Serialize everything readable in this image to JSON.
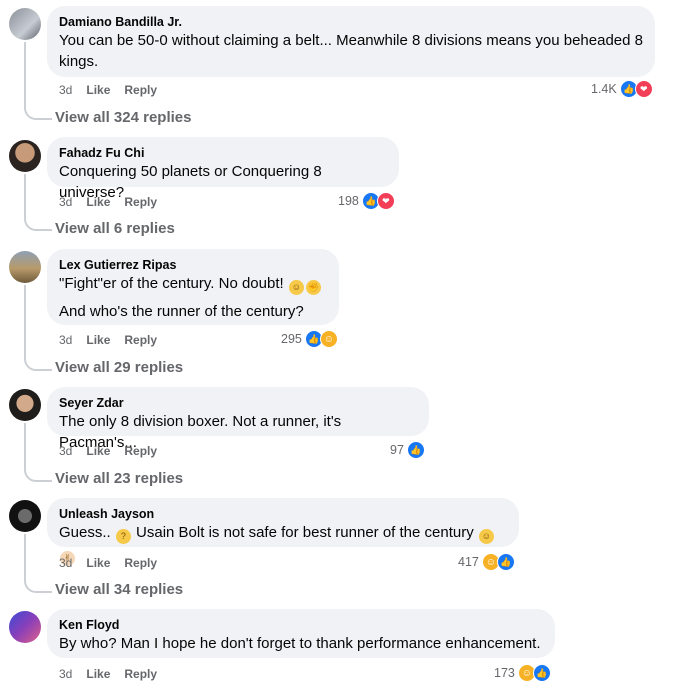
{
  "comments": [
    {
      "author": "Damiano Bandilla Jr.",
      "lines": [
        "You can be 50-0 without claiming a belt... Meanwhile 8 divisions means you beheaded 8",
        "kings."
      ],
      "time": "3d",
      "like": "Like",
      "reply": "Reply",
      "reaction_count": "1.4K",
      "reactions": [
        "like-icon",
        "love-icon"
      ],
      "view_all": "View all 324 replies"
    },
    {
      "author": "Fahadz Fu Chi",
      "lines": [
        "Conquering 50 planets or Conquering 8 universe?"
      ],
      "time": "3d",
      "like": "Like",
      "reply": "Reply",
      "reaction_count": "198",
      "reactions": [
        "like-icon",
        "love-icon"
      ],
      "view_all": "View all 6 replies"
    },
    {
      "author": "Lex Gutierrez Ripas",
      "lines": [
        "\"Fight\"er of the century. No doubt!",
        "And who's the runner of the century?"
      ],
      "time": "3d",
      "like": "Like",
      "reply": "Reply",
      "reaction_count": "295",
      "reactions": [
        "like-icon",
        "haha-icon"
      ],
      "view_all": "View all 29 replies"
    },
    {
      "author": "Seyer Zdar",
      "lines": [
        "The only 8 division boxer. Not a runner, it's Pacman's..."
      ],
      "time": "3d",
      "like": "Like",
      "reply": "Reply",
      "reaction_count": "97",
      "reactions": [
        "like-icon"
      ],
      "view_all": "View all 23 replies"
    },
    {
      "author": "Unleash Jayson",
      "lines": [
        "Guess..",
        "Usain Bolt is not safe for best runner of the century"
      ],
      "time": "3d",
      "like": "Like",
      "reply": "Reply",
      "reaction_count": "417",
      "reactions": [
        "haha-icon",
        "like-icon"
      ],
      "view_all": "View all 34 replies"
    },
    {
      "author": "Ken Floyd",
      "lines": [
        "By who? Man I hope he don't forget to thank performance enhancement."
      ],
      "time": "3d",
      "like": "Like",
      "reply": "Reply",
      "reaction_count": "173",
      "reactions": [
        "haha-icon",
        "like-icon"
      ]
    }
  ],
  "colors": {
    "bubble": "#f0f2f5",
    "like_blue": "#1877f2",
    "love_red": "#f33e58",
    "haha_yellow": "#f7b125",
    "meta_gray": "#65676b"
  }
}
